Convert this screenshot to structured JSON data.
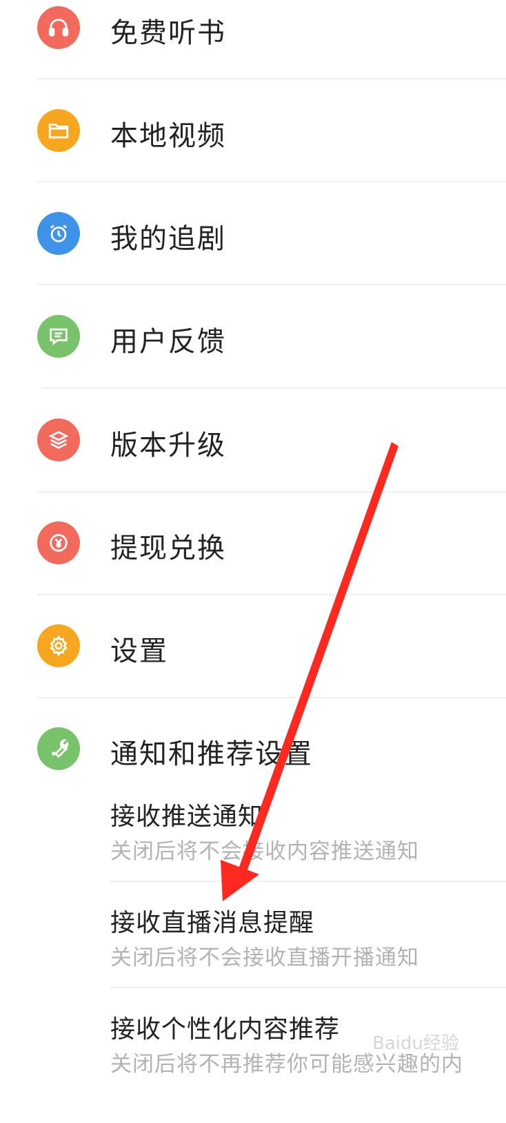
{
  "menu": {
    "items": [
      {
        "label": "免费听书",
        "icon": "headphones-icon",
        "color": "#F26A5B"
      },
      {
        "label": "本地视频",
        "icon": "folder-icon",
        "color": "#F7A71F"
      },
      {
        "label": "我的追剧",
        "icon": "alarm-clock-icon",
        "color": "#3E93E8"
      },
      {
        "label": "用户反馈",
        "icon": "message-icon",
        "color": "#78C26A"
      },
      {
        "label": "版本升级",
        "icon": "layers-icon",
        "color": "#F26A5B"
      },
      {
        "label": "提现兑换",
        "icon": "yen-coin-icon",
        "color": "#F26A5B"
      },
      {
        "label": "设置",
        "icon": "gear-icon",
        "color": "#F7A71F"
      },
      {
        "label": "通知和推荐设置",
        "icon": "wrench-icon",
        "color": "#78C26A"
      }
    ]
  },
  "notifications": {
    "options": [
      {
        "title": "接收推送通知",
        "desc": "关闭后将不会接收内容推送通知"
      },
      {
        "title": "接收直播消息提醒",
        "desc": "关闭后将不会接收直播开播通知"
      },
      {
        "title": "接收个性化内容推荐",
        "desc": "关闭后将不再推荐你可能感兴趣的内"
      }
    ]
  },
  "annotation": {
    "arrow_color": "#FF2A1F"
  },
  "watermark": {
    "text": "Baidu经验"
  }
}
